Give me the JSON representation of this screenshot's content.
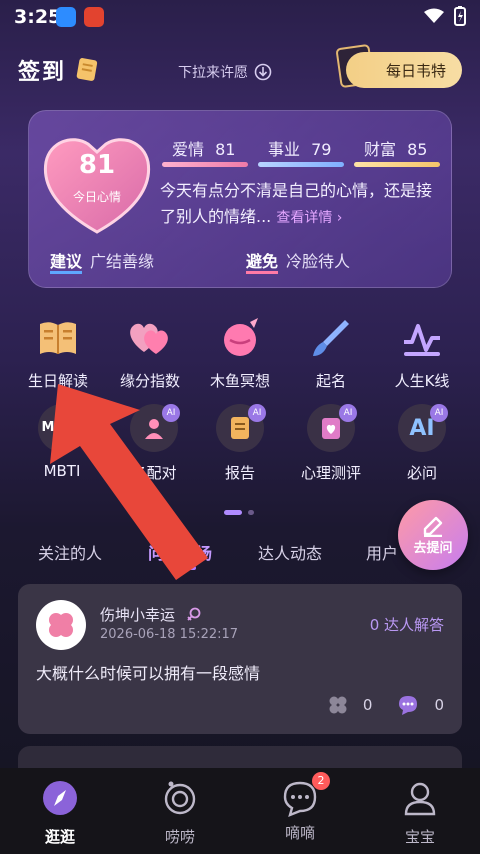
{
  "status_bar": {
    "time": "3:25"
  },
  "header": {
    "title": "签到",
    "pull_hint": "下拉来许愿",
    "daily_button": "每日韦特"
  },
  "mood": {
    "score": "81",
    "score_label": "今日心情",
    "metrics": [
      {
        "label": "爱情",
        "value": "81",
        "color": "#f07aa8"
      },
      {
        "label": "事业",
        "value": "79",
        "color": "#7fb0ff"
      },
      {
        "label": "财富",
        "value": "85",
        "color": "#f5c56a"
      }
    ],
    "description": "今天有点分不清是自己的心情，还是接了别人的情绪...",
    "detail_link": "查看详情 ›",
    "advice": {
      "title": "建议",
      "text": "广结善缘"
    },
    "avoid": {
      "title": "避免",
      "text": "冷脸待人"
    }
  },
  "features_row1": [
    {
      "label": "生日解读",
      "icon": "book-icon"
    },
    {
      "label": "缘分指数",
      "icon": "hearts-icon"
    },
    {
      "label": "木鱼冥想",
      "icon": "wooden-fish-icon"
    },
    {
      "label": "起名",
      "icon": "brush-icon"
    },
    {
      "label": "人生K线",
      "icon": "kline-icon"
    }
  ],
  "features_row2": [
    {
      "label": "MBTI",
      "icon": "mbti-icon",
      "icon_text": "MB TI"
    },
    {
      "label": "名配对",
      "icon": "pair-icon",
      "icon_text": ""
    },
    {
      "label": "报告",
      "icon": "report-icon",
      "icon_text": ""
    },
    {
      "label": "心理测评",
      "icon": "psych-icon",
      "icon_text": ""
    },
    {
      "label": "必问",
      "icon": "ai-icon",
      "icon_text": "AI"
    }
  ],
  "ai_badge": "AI",
  "tabs": [
    {
      "label": "关注的人"
    },
    {
      "label": "问答广场"
    },
    {
      "label": "达人动态"
    },
    {
      "label": "用户"
    }
  ],
  "ask_button": "去提问",
  "post": {
    "user": "伤坤小幸运",
    "time": "2026-06-18 15:22:17",
    "answers": "0 达人解答",
    "text": "大概什么时候可以拥有一段感情",
    "likes": "0",
    "comments": "0"
  },
  "bottom_nav": [
    {
      "label": "逛逛",
      "icon": "compass-icon"
    },
    {
      "label": "唠唠",
      "icon": "bubble-icon"
    },
    {
      "label": "嘀嘀",
      "icon": "chat-icon",
      "badge": "2"
    },
    {
      "label": "宝宝",
      "icon": "user-icon"
    }
  ]
}
